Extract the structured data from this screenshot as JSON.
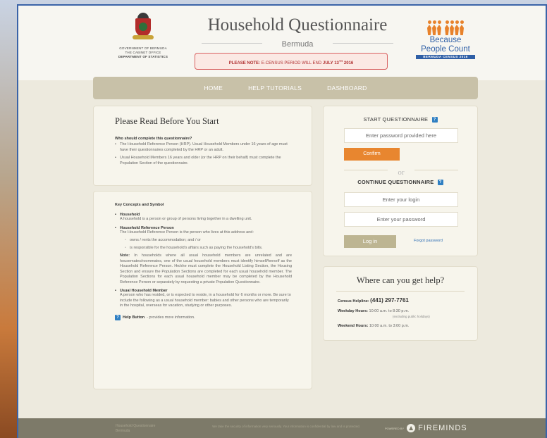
{
  "header": {
    "gov_lines": [
      "GOVERNMENT OF BERMUDA",
      "THE CABINET OFFICE",
      "DEPARTMENT OF STATISTICS"
    ],
    "title": "Household Questionnaire",
    "subtitle": "Bermuda",
    "notice_label": "PLEASE NOTE:",
    "notice_text": "E-CENSUS PERIOD WILL END",
    "notice_date": "JULY 13",
    "notice_sup": "TH",
    "notice_year": "2016",
    "bpc_line1": "Because",
    "bpc_line2": "People Count",
    "bpc_census": "BERMUDA CENSUS 2016"
  },
  "nav": {
    "home": "HOME",
    "tutorials": "HELP TUTORIALS",
    "dashboard": "DASHBOARD"
  },
  "intro": {
    "title": "Please Read Before You Start",
    "question": "Who should complete this questionnaire?",
    "bullets": [
      "The Household Reference Person (HRP). Usual Household Members under 16 years of age must have their questionnaires completed by the HRP or an adult.",
      "Usual Household Members 16 years and older (or the HRP on their behalf) must complete the Population Section of the questionnaire."
    ]
  },
  "concepts": {
    "heading": "Key Concepts and Symbol",
    "household_title": "Household",
    "household_desc": "A household is a person or group of persons living together in a dwelling unit.",
    "hrp_title": "Household Reference Person",
    "hrp_desc": "The Household Reference Person is the person who lives at this address and:",
    "hrp_points": [
      "owns / rents the accommodation; and / or",
      "is responsible for the household's affairs such as paying the household's bills."
    ],
    "note_label": "Note:",
    "note_text": "In households where all usual household members are unrelated and are housemates/roommates, one of the usual household members must identify himself/herself as the Household Reference Person. He/she must complete the Household Listing Section, the Housing Section and ensure the Population Sections are completed for each usual household member. The Population Sections for each usual household member may be completed by the Household Reference Person or separately by requesting a private Population Questionnaire.",
    "uhm_title": "Usual Household Member",
    "uhm_desc": "A person who has resided, or is expected to reside, in a household for 6 months or more. Be sure to include the following as a usual household member: babies and other persons who are temporarily in the hospital, overseas for vacation, studying or other purposes.",
    "help_label": "Help Button",
    "help_text": "- provides more information.",
    "help_icon": "?"
  },
  "start": {
    "heading": "START QUESTIONNAIRE",
    "icon": "?",
    "password_placeholder": "Enter password provided here",
    "confirm_label": "Confirm",
    "or_text": "or",
    "continue_heading": "CONTINUE QUESTIONNAIRE",
    "login_placeholder": "Enter your login",
    "pw_placeholder": "Enter your password",
    "login_label": "Log in",
    "forgot_label": "Forgot password"
  },
  "help": {
    "title": "Where can you get help?",
    "helpline_label": "Census Helpline:",
    "helpline_number": "(441) 297-7761",
    "weekday_label": "Weekday Hours:",
    "weekday_hours": "10:00 a.m. to 8:30 p.m.",
    "weekday_note": "(excluding public holidays)",
    "weekend_label": "Weekend Hours:",
    "weekend_hours": "10:00 a.m. to 3:00 p.m."
  },
  "footer": {
    "left_line1": "Household Questionnaire",
    "left_line2": "Bermuda",
    "mid_text": "We take the security of information very seriously. Your information is confidential by law and is protected.",
    "powered": "POWERED BY",
    "brand": "FIREMINDS"
  },
  "colors": {
    "accent_orange": "#e8862f",
    "nav": "#c8c1a8",
    "brand_blue": "#2f5fa6",
    "notice_red": "#d86060"
  }
}
